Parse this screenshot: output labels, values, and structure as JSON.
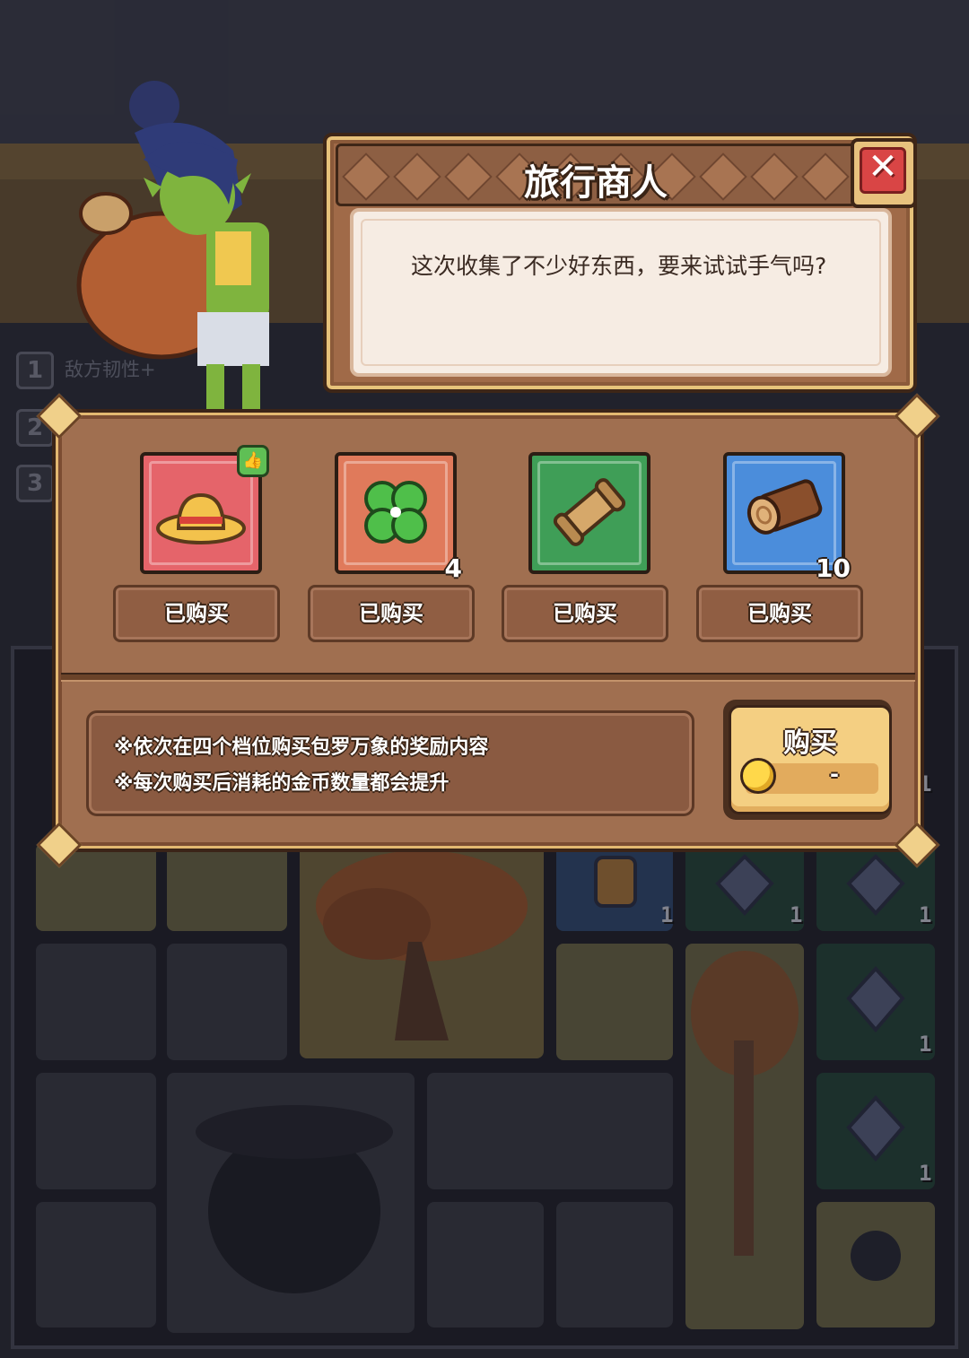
{
  "dialog": {
    "title": "旅行商人",
    "message": "这次收集了不少好东西，要来试试手气吗?"
  },
  "side_panel": {
    "slots": [
      "1",
      "2",
      "3"
    ],
    "effect_text": "敌方韧性+"
  },
  "shop": {
    "items": [
      {
        "icon": "straw-hat-icon",
        "box_color": "#e5646a",
        "count": "",
        "recommended": true,
        "button_label": "已购买"
      },
      {
        "icon": "four-leaf-clover-icon",
        "box_color": "#e07a5b",
        "count": "4",
        "recommended": false,
        "button_label": "已购买"
      },
      {
        "icon": "scroll-icon",
        "box_color": "#3f9e57",
        "count": "",
        "recommended": false,
        "button_label": "已购买"
      },
      {
        "icon": "wood-log-icon",
        "box_color": "#4b8ddb",
        "count": "10",
        "recommended": false,
        "button_label": "已购买"
      }
    ],
    "description_lines": [
      "※依次在四个档位购买包罗万象的奖励内容",
      "※每次购买后消耗的金币数量都会提升"
    ],
    "buy_button": {
      "label": "购买",
      "price": "-",
      "currency_icon": "gold-coin-icon"
    }
  },
  "board": {
    "tile_counts": [
      "1",
      "1",
      "1",
      "1",
      "1",
      "1"
    ]
  },
  "colors": {
    "panel_brown": "#a06f50",
    "frame_dark": "#3b2418",
    "accent_gold": "#f4cf82",
    "close_red": "#d94545"
  }
}
